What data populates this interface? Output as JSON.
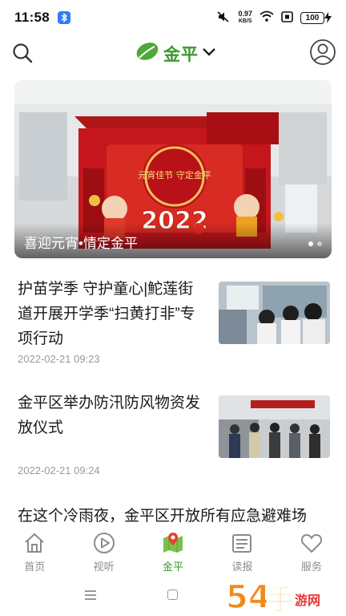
{
  "status_bar": {
    "time": "11:58",
    "net_speed_value": "0.97",
    "net_speed_unit": "KB/S",
    "battery": "100"
  },
  "header": {
    "brand": "金平"
  },
  "banner": {
    "caption": "喜迎元宵•情定金平",
    "sign_text": "元宵佳节 守定金平",
    "year_text": "2022",
    "dots_total": 2,
    "active_index": 0
  },
  "news": [
    {
      "title_lines": [
        "护苗学季 守护童心|鮀莲街",
        "道开展开学季“扫黄打非”专",
        "项行动"
      ],
      "date": "2022-02-21 09:23"
    },
    {
      "title_lines": [
        "金平区举办防汛防风物资发",
        "放仪式"
      ],
      "date": "2022-02-21 09:24"
    },
    {
      "title_lines": [
        "在这个冷雨夜，金平区开放所有应急避难场"
      ],
      "date": ""
    }
  ],
  "bottom_nav": {
    "items": [
      {
        "label": "首页",
        "icon": "home-icon",
        "active": false
      },
      {
        "label": "视听",
        "icon": "play-icon",
        "active": false
      },
      {
        "label": "金平",
        "icon": "map-icon",
        "active": true
      },
      {
        "label": "读报",
        "icon": "newspaper-icon",
        "active": false
      },
      {
        "label": "服务",
        "icon": "heart-icon",
        "active": false
      }
    ]
  },
  "watermark": {
    "text": "54手游网"
  },
  "colors": {
    "brand_green": "#3a9a2c",
    "inactive_gray": "#8c8c8c",
    "date_gray": "#9a9a9a"
  }
}
